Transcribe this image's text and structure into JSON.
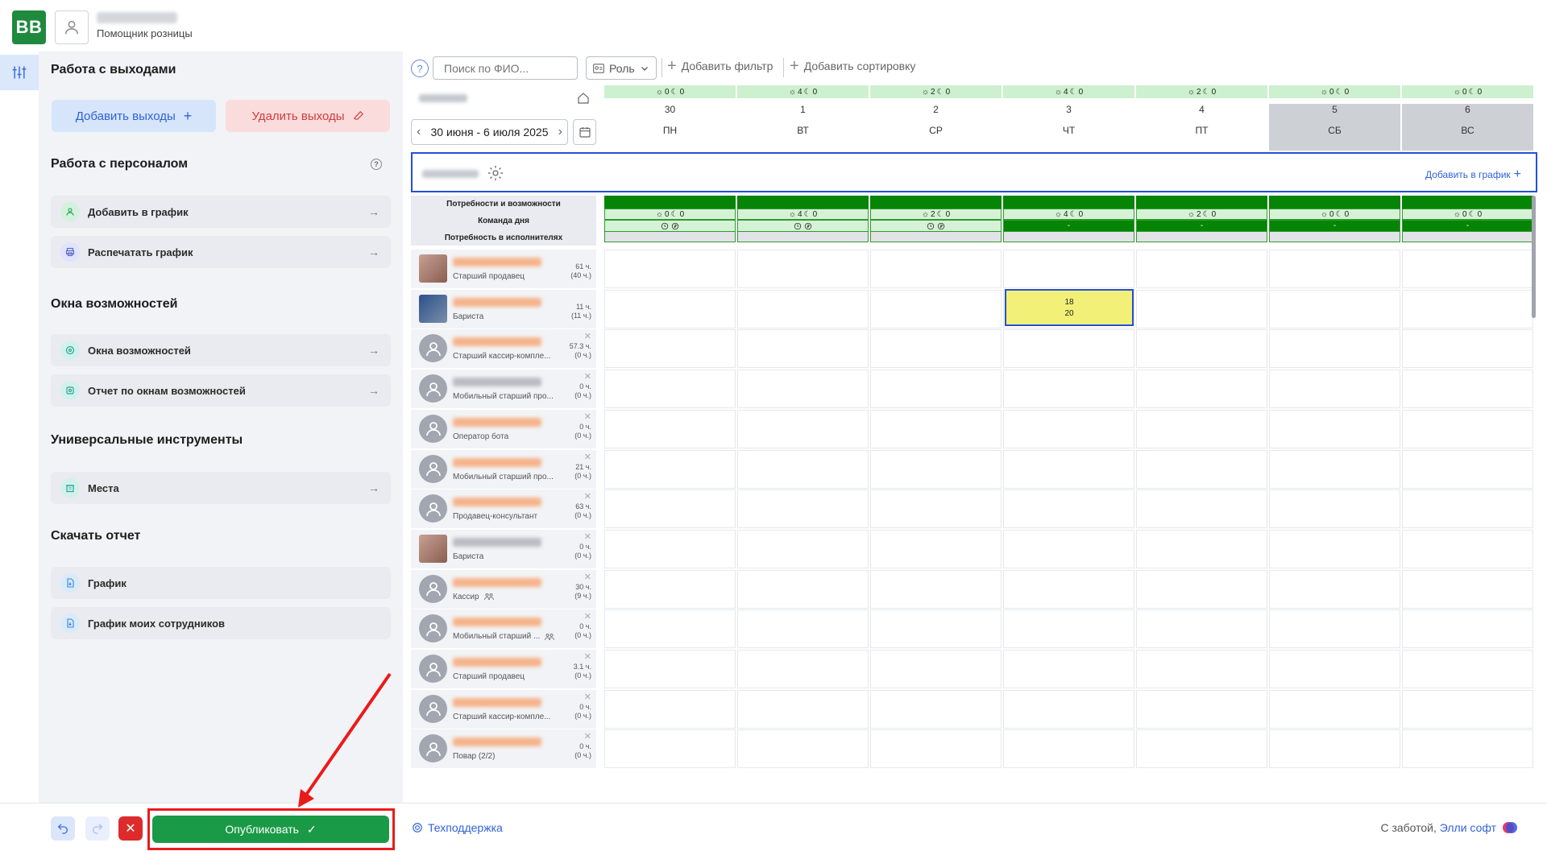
{
  "header": {
    "logo_text": "BB",
    "user_role": "Помощник розницы"
  },
  "sidebar": {
    "section_outputs": "Работа с выходами",
    "add_outputs": "Добавить выходы",
    "delete_outputs": "Удалить выходы",
    "section_staff": "Работа с персоналом",
    "staff_items": [
      "Добавить в график",
      "Распечатать график"
    ],
    "section_windows": "Окна возможностей",
    "window_items": [
      "Окна возможностей",
      "Отчет по окнам возможностей"
    ],
    "section_tools": "Универсальные инструменты",
    "tool_items": [
      "Места"
    ],
    "section_report": "Скачать отчет",
    "report_items": [
      "График",
      "График моих сотрудников"
    ]
  },
  "toolbar": {
    "help": "?",
    "search_placeholder": "Поиск по ФИО...",
    "role_label": "Роль",
    "add_filter": "Добавить фильтр",
    "add_sort": "Добавить сортировку"
  },
  "calendar": {
    "week_range": "30 июня - 6 июля 2025",
    "days": [
      {
        "num": "30",
        "name": "ПН",
        "a": "0",
        "b": "0",
        "weekend": false
      },
      {
        "num": "1",
        "name": "ВТ",
        "a": "4",
        "b": "0",
        "weekend": false
      },
      {
        "num": "2",
        "name": "СР",
        "a": "2",
        "b": "0",
        "weekend": false
      },
      {
        "num": "3",
        "name": "ЧТ",
        "a": "4",
        "b": "0",
        "weekend": false
      },
      {
        "num": "4",
        "name": "ПТ",
        "a": "2",
        "b": "0",
        "weekend": false
      },
      {
        "num": "5",
        "name": "СБ",
        "a": "0",
        "b": "0",
        "weekend": true
      },
      {
        "num": "6",
        "name": "ВС",
        "a": "0",
        "b": "0",
        "weekend": true
      }
    ],
    "team_add": "Добавить в график",
    "needs_labels": [
      "Потребности и возможности",
      "Команда дня",
      "Потребность в исполнителях"
    ],
    "needs_dash": "-"
  },
  "employees": [
    {
      "role": "Старший продавец",
      "hours": "61 ч.",
      "hours_sub": "(40 ч.)",
      "photo": true,
      "name_color": "orange"
    },
    {
      "role": "Бариста",
      "hours": "11 ч.",
      "hours_sub": "(11 ч.)",
      "photo": true,
      "name_color": "orange"
    },
    {
      "role": "Старший кассир-компле...",
      "hours": "57.3 ч.",
      "hours_sub": "(0 ч.)",
      "photo": false,
      "name_color": "orange"
    },
    {
      "role": "Мобильный старший про...",
      "hours": "0 ч.",
      "hours_sub": "(0 ч.)",
      "photo": false,
      "name_color": "gray"
    },
    {
      "role": "Оператор бота",
      "hours": "0 ч.",
      "hours_sub": "(0 ч.)",
      "photo": false,
      "name_color": "orange"
    },
    {
      "role": "Мобильный старший про...",
      "hours": "21 ч.",
      "hours_sub": "(0 ч.)",
      "photo": false,
      "name_color": "orange"
    },
    {
      "role": "Продавец-консультант",
      "hours": "63 ч.",
      "hours_sub": "(0 ч.)",
      "photo": false,
      "name_color": "orange"
    },
    {
      "role": "Бариста",
      "hours": "0 ч.",
      "hours_sub": "(0 ч.)",
      "photo": true,
      "name_color": "gray"
    },
    {
      "role": "Кассир",
      "hours": "30 ч.",
      "hours_sub": "(9 ч.)",
      "photo": false,
      "name_color": "orange",
      "team_icon": true
    },
    {
      "role": "Мобильный старший ...",
      "hours": "0 ч.",
      "hours_sub": "(0 ч.)",
      "photo": false,
      "name_color": "orange",
      "team_icon": true
    },
    {
      "role": "Старший продавец",
      "hours": "3.1 ч.",
      "hours_sub": "(0 ч.)",
      "photo": false,
      "name_color": "orange"
    },
    {
      "role": "Старший кассир-компле...",
      "hours": "0 ч.",
      "hours_sub": "(0 ч.)",
      "photo": false,
      "name_color": "orange"
    },
    {
      "role": "Повар (2/2)",
      "hours": "0 ч.",
      "hours_sub": "(0 ч.)",
      "photo": false,
      "name_color": "orange"
    }
  ],
  "shift": {
    "start": "18",
    "end": "20"
  },
  "footer": {
    "publish": "Опубликовать",
    "support": "Техподдержка",
    "care_prefix": "С заботой,",
    "care_brand": "Элли софт"
  },
  "colors": {
    "accent_green": "#1a9a46",
    "brand_blue": "#2f62d8",
    "need_green": "#068406",
    "annotation_red": "#ea1b1b",
    "shift_yellow": "#f3f077"
  }
}
